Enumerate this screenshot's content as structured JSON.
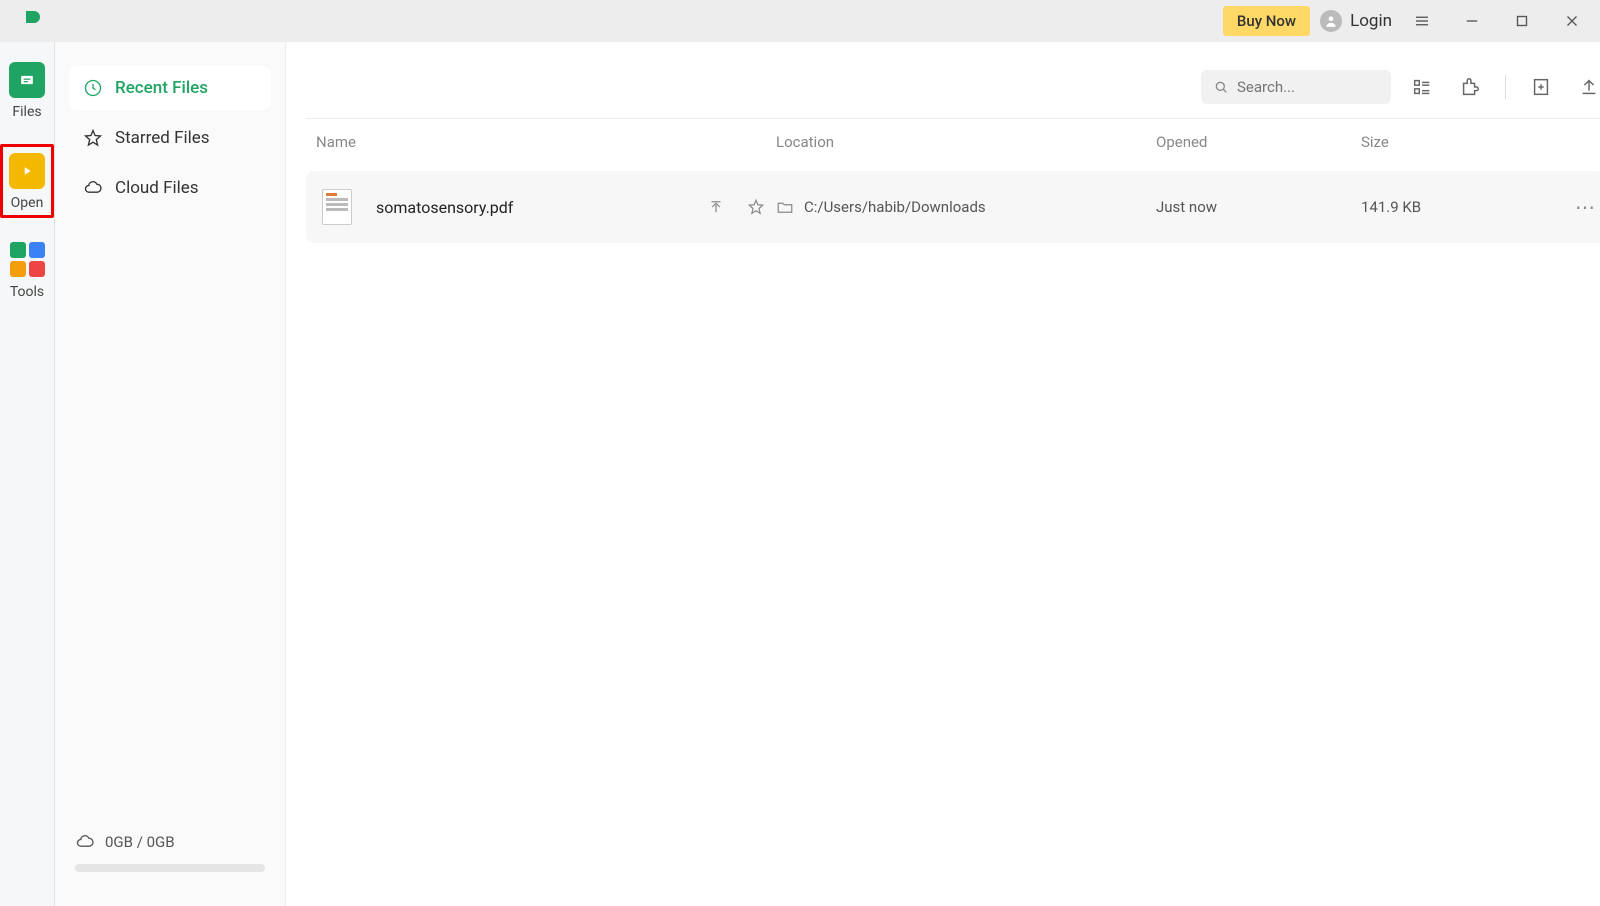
{
  "titlebar": {
    "buy_now": "Buy Now",
    "login": "Login"
  },
  "rail": {
    "files": "Files",
    "open": "Open",
    "tools": "Tools"
  },
  "sidebar": {
    "recent": "Recent Files",
    "starred": "Starred Files",
    "cloud": "Cloud Files",
    "storage": "0GB / 0GB"
  },
  "topbar": {
    "search_placeholder": "Search..."
  },
  "table": {
    "headers": {
      "name": "Name",
      "location": "Location",
      "opened": "Opened",
      "size": "Size"
    },
    "rows": [
      {
        "name": "somatosensory.pdf",
        "location": "C:/Users/habib/Downloads",
        "opened": "Just now",
        "size": "141.9 KB"
      }
    ]
  }
}
